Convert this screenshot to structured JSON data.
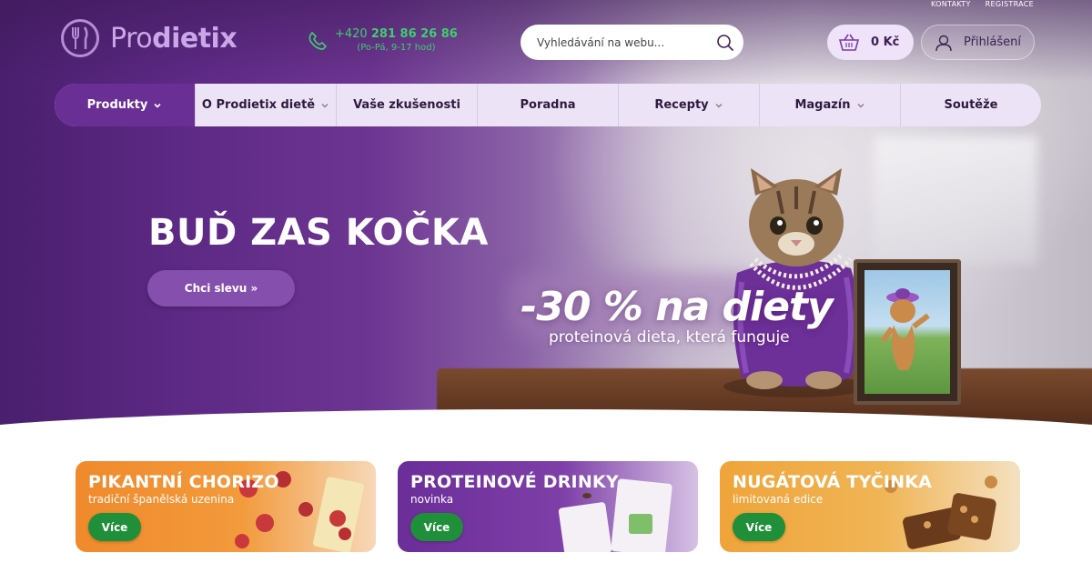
{
  "toplinks": {
    "contacts": "KONTAKTY",
    "register": "REGISTRACE"
  },
  "logo": {
    "light": "Pro",
    "bold": "dietix"
  },
  "phone": {
    "prefix": "+420",
    "number": "281 86 26 86",
    "hours": "(Po-Pá, 9-17 hod)"
  },
  "search": {
    "placeholder": "Vyhledávání na webu..."
  },
  "cart": {
    "value": "0 Kč"
  },
  "login": {
    "label": "Přihlášení"
  },
  "nav": [
    {
      "label": "Produkty",
      "dropdown": true,
      "active": true
    },
    {
      "label": "O Prodietix dietě",
      "dropdown": true
    },
    {
      "label": "Vaše zkušenosti",
      "dropdown": false
    },
    {
      "label": "Poradna",
      "dropdown": false
    },
    {
      "label": "Recepty",
      "dropdown": true
    },
    {
      "label": "Magazín",
      "dropdown": true
    },
    {
      "label": "Soutěže",
      "dropdown": false
    }
  ],
  "hero": {
    "title": "BUĎ ZAS KOČKA",
    "button": "Chci slevu »",
    "promo": "-30 % na diety",
    "promo_sub": "proteinová dieta, která funguje"
  },
  "cards": [
    {
      "title": "PIKANTNÍ CHORIZO",
      "subtitle": "tradiční španělská uzenina",
      "button": "Více"
    },
    {
      "title": "PROTEINOVÉ DRINKY",
      "subtitle": "novinka",
      "button": "Více"
    },
    {
      "title": "NUGÁTOVÁ TYČINKA",
      "subtitle": "limitovaná edice",
      "button": "Více"
    }
  ],
  "colors": {
    "brand_purple": "#6a2f95",
    "accent_green": "#3fce6e",
    "button_green": "#1f8f3a",
    "nav_bg": "#ece4f6",
    "cart_bg": "#efe3fa"
  }
}
